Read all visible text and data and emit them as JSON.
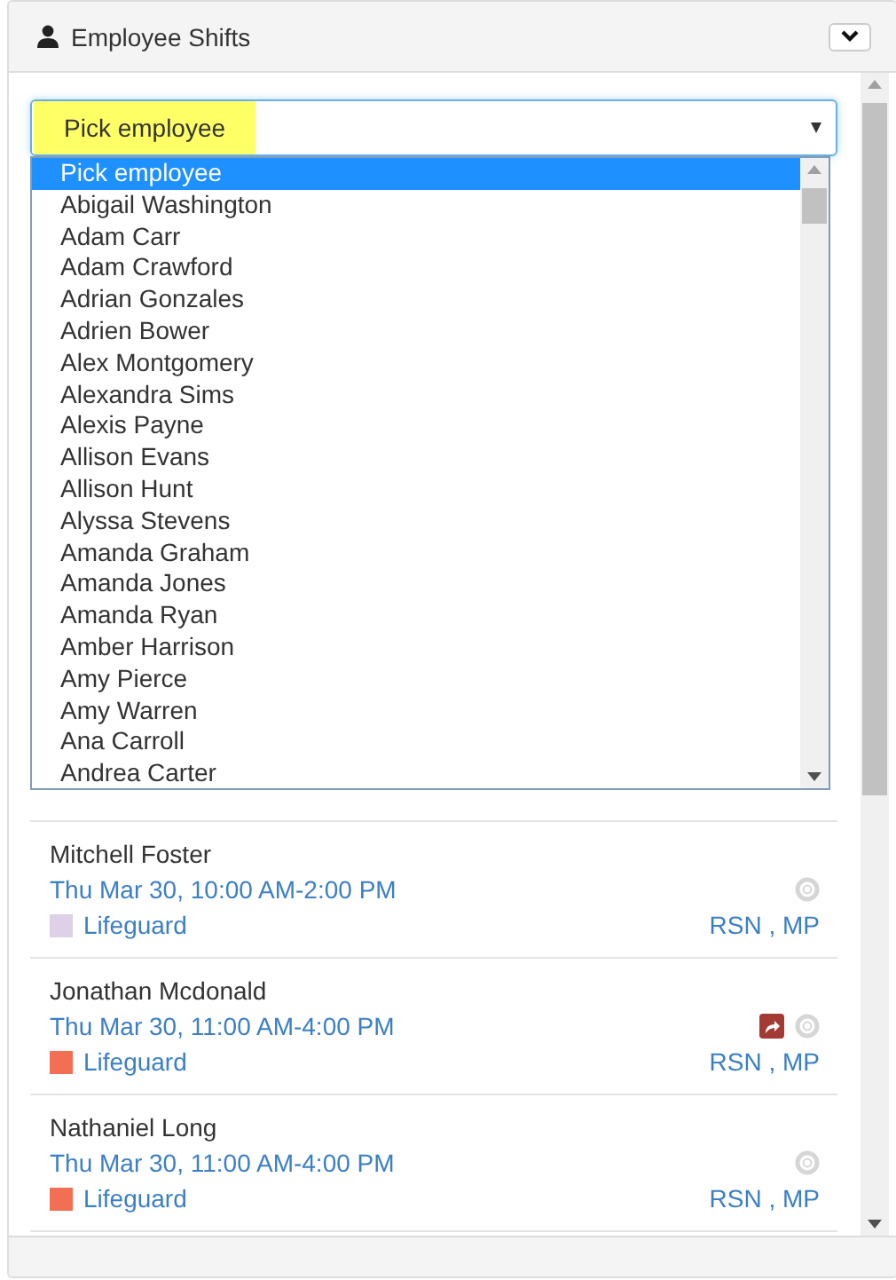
{
  "panel": {
    "title": "Employee Shifts"
  },
  "select": {
    "value": "Pick employee",
    "highlighted": true,
    "expanded": true,
    "options": [
      {
        "label": "Pick employee",
        "selected": true
      },
      {
        "label": "Abigail Washington",
        "selected": false
      },
      {
        "label": "Adam Carr",
        "selected": false
      },
      {
        "label": "Adam Crawford",
        "selected": false
      },
      {
        "label": "Adrian Gonzales",
        "selected": false
      },
      {
        "label": "Adrien Bower",
        "selected": false
      },
      {
        "label": "Alex Montgomery",
        "selected": false
      },
      {
        "label": "Alexandra Sims",
        "selected": false
      },
      {
        "label": "Alexis Payne",
        "selected": false
      },
      {
        "label": "Allison Evans",
        "selected": false
      },
      {
        "label": "Allison Hunt",
        "selected": false
      },
      {
        "label": "Alyssa Stevens",
        "selected": false
      },
      {
        "label": "Amanda Graham",
        "selected": false
      },
      {
        "label": "Amanda Jones",
        "selected": false
      },
      {
        "label": "Amanda Ryan",
        "selected": false
      },
      {
        "label": "Amber Harrison",
        "selected": false
      },
      {
        "label": "Amy Pierce",
        "selected": false
      },
      {
        "label": "Amy Warren",
        "selected": false
      },
      {
        "label": "Ana Carroll",
        "selected": false
      },
      {
        "label": "Andrea Carter",
        "selected": false
      }
    ]
  },
  "shifts": [
    {
      "name": "Mitchell Foster",
      "time": "Thu Mar 30, 10:00 AM-2:00 PM",
      "role": "Lifeguard",
      "color": "#ddd0e8",
      "codes": "RSN , MP",
      "forwarded": false
    },
    {
      "name": "Jonathan Mcdonald",
      "time": "Thu Mar 30, 11:00 AM-4:00 PM",
      "role": "Lifeguard",
      "color": "#f26f55",
      "codes": "RSN , MP",
      "forwarded": true
    },
    {
      "name": "Nathaniel Long",
      "time": "Thu Mar 30, 11:00 AM-4:00 PM",
      "role": "Lifeguard",
      "color": "#f26f55",
      "codes": "RSN , MP",
      "forwarded": false
    }
  ]
}
